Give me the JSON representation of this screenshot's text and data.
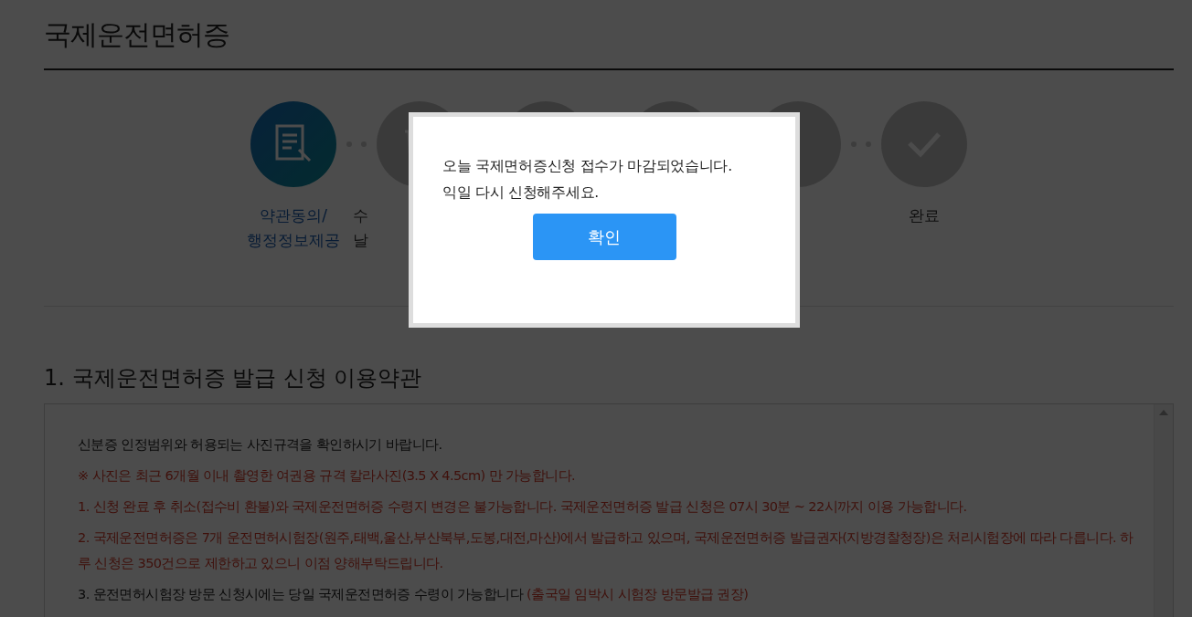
{
  "page": {
    "title": "국제운전면허증"
  },
  "steps": [
    {
      "selected": true,
      "label": [
        "약관동의/",
        "행정정보제공"
      ]
    },
    {
      "selected": false,
      "label": [
        "수",
        "날"
      ]
    },
    {
      "selected": false
    },
    {
      "selected": false
    },
    {
      "selected": false
    },
    {
      "selected": false,
      "label": [
        "완료"
      ]
    }
  ],
  "terms": {
    "heading": "1. 국제운전면허증 발급 신청 이용약관",
    "paragraphs": [
      {
        "segments": [
          {
            "kind": "plain",
            "text": "신분증 인정범위와 허용되는 사진규격을 확인하시기 바랍니다."
          }
        ]
      },
      {
        "segments": [
          {
            "kind": "notice",
            "text": "※ 사진은 최근 6개월 이내 촬영한 여권용 규격 칼라사진(3.5 X 4.5cm) 만 가능합니다."
          }
        ]
      },
      {
        "segments": [
          {
            "kind": "notice",
            "text": "1. 신청 완료 후 취소(접수비 환불)와 국제운전면허증 수령지 변경은 불가능합니다. 국제운전면허증 발급 신청은 07시 30분 ~ 22시까지 이용 가능합니다."
          }
        ]
      },
      {
        "segments": [
          {
            "kind": "notice",
            "text": "2. 국제운전면허증은 7개 운전면허시험장(원주,태백,울산,부산북부,도봉,대전,마산)에서 발급하고 있으며, 국제운전면허증 발급권자(지방경찰청장)은 처리시험장에 따라 다릅니다. 하루 신청은 350건으로 제한하고 있으니 이점 양해부탁드립니다."
          }
        ]
      },
      {
        "segments": [
          {
            "kind": "plain",
            "text": "3. 운전면허시험장 방문 신청시에는 당일 국제운전면허증 수령이 가능합니다 "
          },
          {
            "kind": "notice",
            "text": "(출국일 임박시 시험장 방문발급 권장)"
          }
        ]
      }
    ]
  },
  "dialog": {
    "lines": [
      "오늘 국제면허증신청 접수가 마감되었습니다.",
      "익일 다시 신청해주세요."
    ],
    "button": "확인"
  }
}
